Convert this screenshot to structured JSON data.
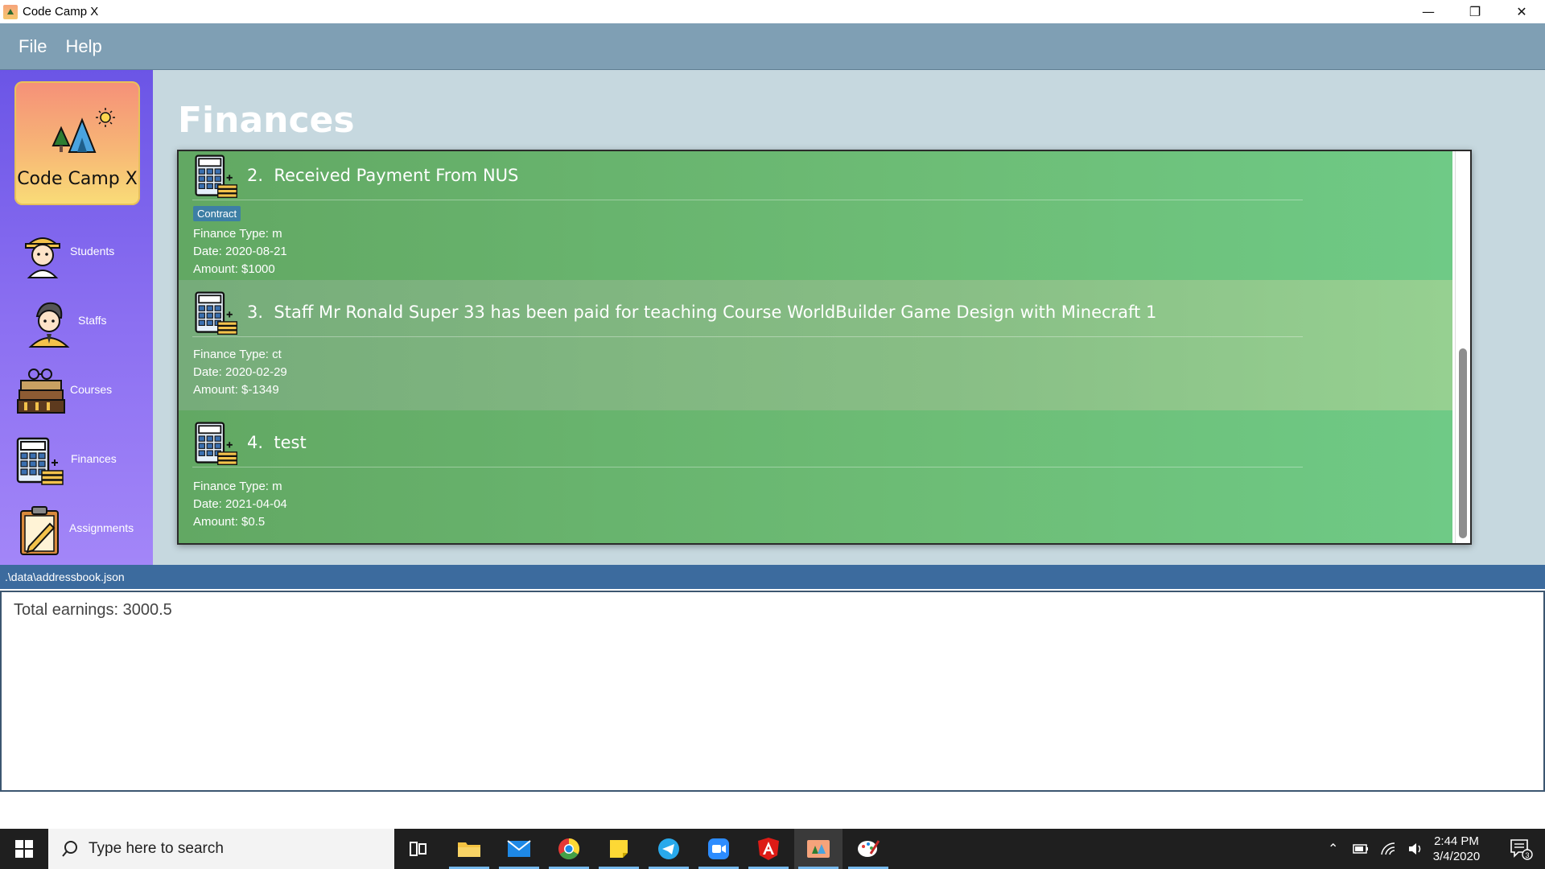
{
  "window": {
    "title": "Code Camp X"
  },
  "menu": {
    "file": "File",
    "help": "Help"
  },
  "sidebar": {
    "logo_text": "Code Camp X",
    "items": [
      {
        "label": "Students",
        "icon": "student-icon"
      },
      {
        "label": "Staffs",
        "icon": "staff-icon"
      },
      {
        "label": "Courses",
        "icon": "courses-icon"
      },
      {
        "label": "Finances",
        "icon": "calculator-icon"
      },
      {
        "label": "Assignments",
        "icon": "clipboard-icon"
      }
    ]
  },
  "main": {
    "title": "Finances",
    "cards": [
      {
        "index": "2.",
        "title": "Received Payment From NUS",
        "tag": "Contract",
        "type": "Finance Type: m",
        "date": "Date: 2020-08-21",
        "amount": "Amount: $1000"
      },
      {
        "index": "3.",
        "title": "Staff Mr Ronald Super 33 has been paid for teaching Course WorldBuilder Game Design with Minecraft 1",
        "type": "Finance Type: ct",
        "date": "Date: 2020-02-29",
        "amount": "Amount: $-1349"
      },
      {
        "index": "4.",
        "title": "test",
        "type": "Finance Type: m",
        "date": "Date: 2021-04-04",
        "amount": "Amount: $0.5"
      }
    ]
  },
  "status": {
    "path": ".\\data\\addressbook.json"
  },
  "result": {
    "text": "Total earnings: 3000.5"
  },
  "taskbar": {
    "search_placeholder": "Type here to search",
    "time": "2:44 PM",
    "date": "3/4/2020",
    "notification_count": "3"
  },
  "colors": {
    "menubar": "#7f9fb4",
    "card": "#6dbd76",
    "pathbar": "#3c6b9e",
    "sidebar": "#8b6ff1"
  }
}
